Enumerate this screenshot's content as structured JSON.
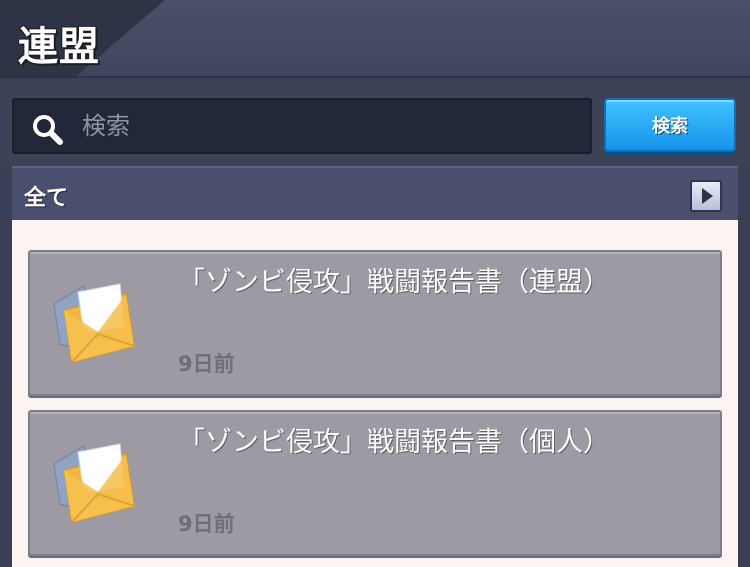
{
  "header": {
    "title": "連盟"
  },
  "search": {
    "placeholder": "検索",
    "value": "",
    "button_label": "検索"
  },
  "category": {
    "label": "全て"
  },
  "mails": [
    {
      "title": "「ゾンビ侵攻」戦闘報告書（連盟）",
      "time": "9日前"
    },
    {
      "title": "「ゾンビ侵攻」戦闘報告書（個人）",
      "time": "9日前"
    }
  ],
  "colors": {
    "accent_button": "#1fa8f5",
    "list_background": "#fbf4f3",
    "item_background": "#9d9aa3",
    "envelope": "#f5c04a"
  },
  "icons": [
    "search-icon",
    "arrow-right-icon",
    "envelope-icon"
  ]
}
